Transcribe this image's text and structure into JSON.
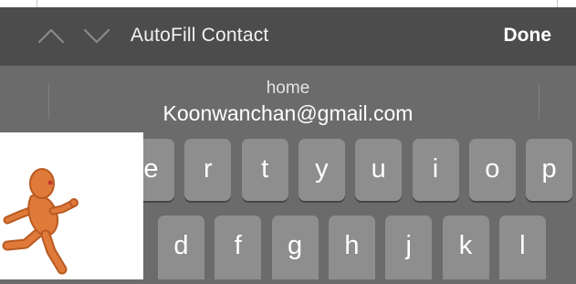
{
  "accessory_bar": {
    "title": "AutoFill Contact",
    "done_label": "Done",
    "prev_icon": "chevron-up-icon",
    "next_icon": "chevron-down-icon"
  },
  "suggestion": {
    "label": "home",
    "value": "Koonwanchan@gmail.com"
  },
  "keyboard": {
    "row1": [
      "e",
      "r",
      "t",
      "y",
      "u",
      "i",
      "o",
      "p"
    ],
    "row2": [
      "d",
      "f",
      "g",
      "h",
      "j",
      "k",
      "l"
    ]
  },
  "sticker": {
    "icon": "running-figure-icon"
  },
  "colors": {
    "accessory_bg": "#4c4c4c",
    "keyboard_bg": "#6b6b6b",
    "key_bg": "#8e8e8e",
    "figure": "#e07a3a"
  }
}
